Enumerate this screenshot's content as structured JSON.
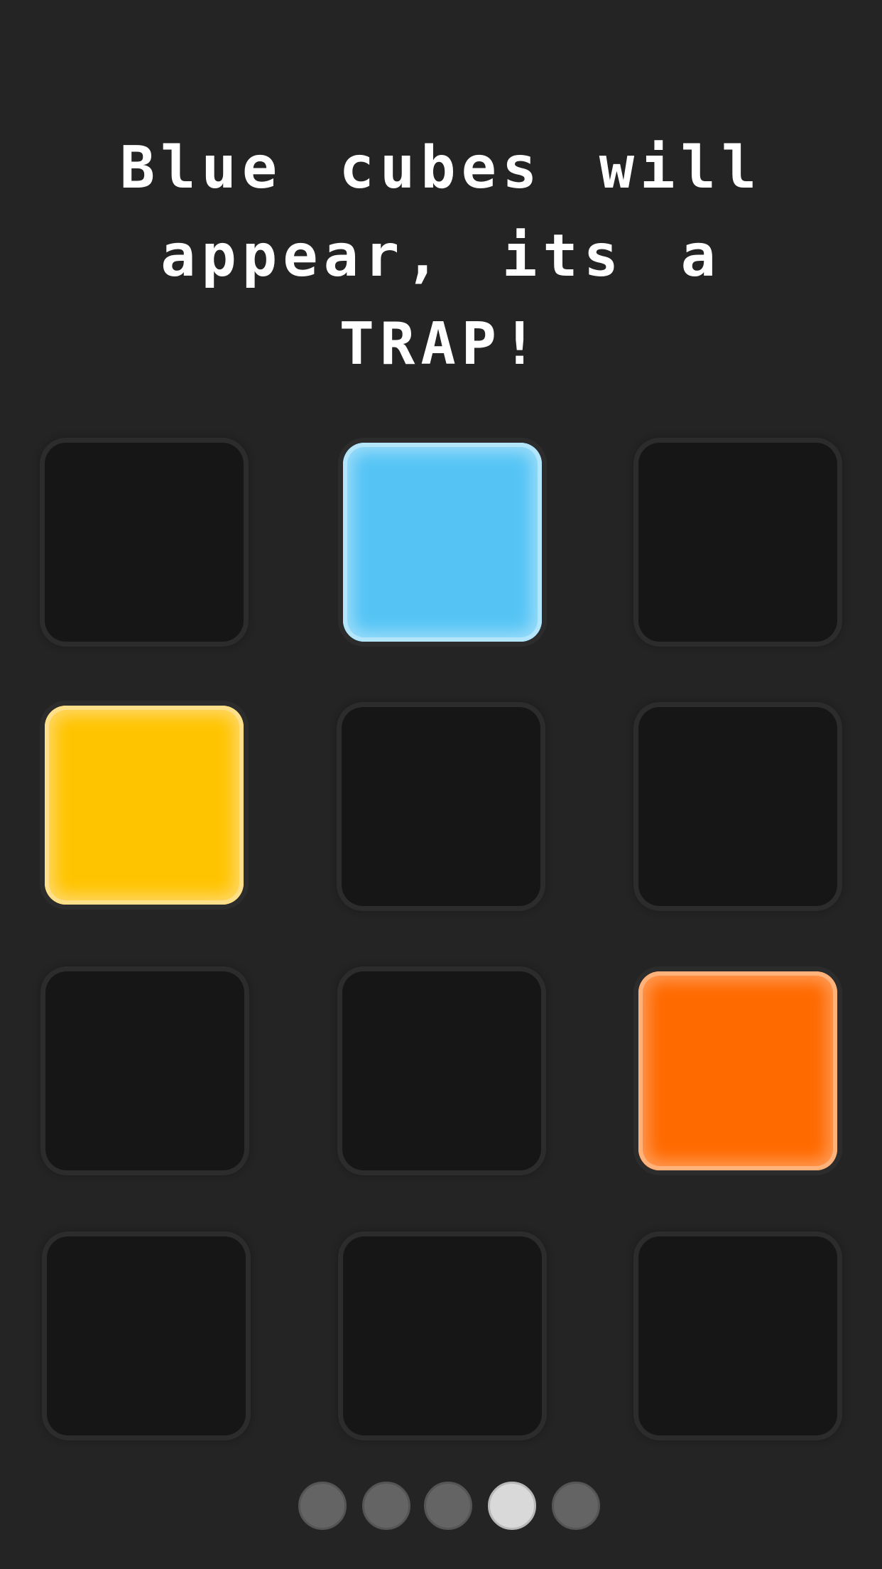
{
  "title": "Blue cubes will appear, its a TRAP!",
  "grid": {
    "rows": 4,
    "columns": 3,
    "cells": [
      {
        "row": 1,
        "col": 1,
        "color": "empty"
      },
      {
        "row": 1,
        "col": 2,
        "color": "blue",
        "hex": "#55c4f5"
      },
      {
        "row": 1,
        "col": 3,
        "color": "empty"
      },
      {
        "row": 2,
        "col": 1,
        "color": "yellow",
        "hex": "#ffc400"
      },
      {
        "row": 2,
        "col": 2,
        "color": "empty"
      },
      {
        "row": 2,
        "col": 3,
        "color": "empty"
      },
      {
        "row": 3,
        "col": 1,
        "color": "empty"
      },
      {
        "row": 3,
        "col": 2,
        "color": "empty"
      },
      {
        "row": 3,
        "col": 3,
        "color": "orange",
        "hex": "#ff6a00"
      },
      {
        "row": 4,
        "col": 1,
        "color": "empty"
      },
      {
        "row": 4,
        "col": 2,
        "color": "empty"
      },
      {
        "row": 4,
        "col": 3,
        "color": "empty"
      }
    ]
  },
  "pagination": {
    "total_pages": 5,
    "current_page": 4
  },
  "colors": {
    "background": "#242424",
    "empty_cell": "#161616",
    "blue": "#55c4f5",
    "yellow": "#ffc400",
    "orange": "#ff6a00",
    "dot_inactive": "#646464",
    "dot_active": "#d9d9d9"
  }
}
